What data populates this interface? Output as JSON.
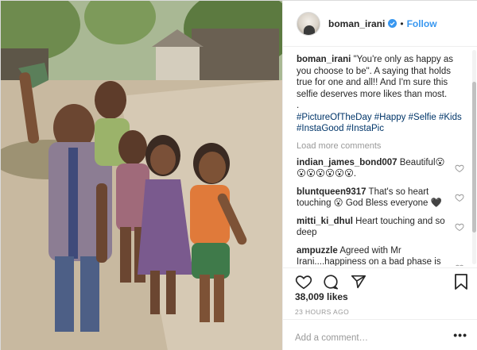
{
  "post": {
    "username": "boman_irani",
    "follow_label": "Follow",
    "separator": "•",
    "caption_user": "boman_irani",
    "caption_text": " \"You're only as happy as you choose to be\". A saying that holds true for one and all!! And I'm sure this selfie deserves more likes than most.",
    "caption_dot": ".",
    "hashtags": "#PictureOfTheDay #Happy #Selfie #Kids #InstaGood #InstaPic",
    "load_more": "Load more comments",
    "comments": [
      {
        "user": "indian_james_bond007",
        "text": " Beautiful😮😮😮😮😮😮😮."
      },
      {
        "user": "bluntqueen9317",
        "text": " That's so heart touching 😮 God Bless everyone 🖤"
      },
      {
        "user": "mitti_ki_dhul",
        "text": " Heart touching and so deep"
      },
      {
        "user": "ampuzzle",
        "text": " Agreed with Mr Irani....happiness on a bad phase is what makes them stronger in the long run.."
      }
    ],
    "likes": "38,009 likes",
    "time": "23 HOURS AGO",
    "add_comment_placeholder": "Add a comment…",
    "more_label": "•••"
  },
  "icons": {
    "verified": "verified-badge-icon",
    "like": "heart-icon",
    "comment": "comment-bubble-icon",
    "share": "share-arrow-icon",
    "save": "bookmark-icon"
  },
  "colors": {
    "link": "#3897f0",
    "hashtag": "#003569",
    "muted": "#999999",
    "border": "#efefef"
  }
}
